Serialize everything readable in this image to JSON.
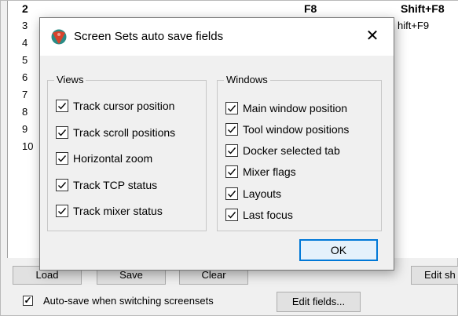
{
  "background": {
    "rows": [
      "2",
      "3",
      "4",
      "5",
      "6",
      "7",
      "8",
      "9",
      "10"
    ],
    "keys": {
      "f8": "F8",
      "shift_f8": "Shift+F8",
      "shift_f9": "hift+F9"
    },
    "buttons": {
      "load": "Load",
      "save": "Save",
      "clear": "Clear",
      "edit_shortcut": "Edit sh"
    },
    "autosave_label": "Auto-save when switching screensets",
    "autosave_checked": true,
    "edit_fields_label": "Edit fields..."
  },
  "dialog": {
    "title": "Screen Sets auto save fields",
    "close_glyph": "✕",
    "views": {
      "title": "Views",
      "items": [
        {
          "label": "Track cursor position",
          "checked": true
        },
        {
          "label": "Track scroll positions",
          "checked": true
        },
        {
          "label": "Horizontal zoom",
          "checked": true
        },
        {
          "label": "Track TCP status",
          "checked": true
        },
        {
          "label": "Track mixer status",
          "checked": true
        }
      ]
    },
    "windows": {
      "title": "Windows",
      "items": [
        {
          "label": "Main window position",
          "checked": true
        },
        {
          "label": "Tool window positions",
          "checked": true
        },
        {
          "label": "Docker selected tab",
          "checked": true
        },
        {
          "label": "Mixer flags",
          "checked": true
        },
        {
          "label": "Layouts",
          "checked": true
        },
        {
          "label": "Last focus",
          "checked": true
        }
      ]
    },
    "ok_label": "OK"
  },
  "colors": {
    "accent": "#0078d7",
    "logo_red": "#d8432c",
    "logo_teal": "#2a8c86"
  }
}
